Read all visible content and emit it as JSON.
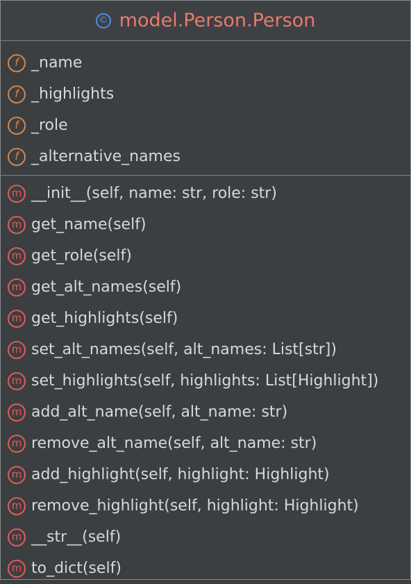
{
  "class": {
    "icon": "class-icon",
    "icon_glyph": "©",
    "name": "model.Person.Person"
  },
  "fields": [
    {
      "icon": "field-icon",
      "glyph": "f",
      "label": "_name"
    },
    {
      "icon": "field-icon",
      "glyph": "f",
      "label": "_highlights"
    },
    {
      "icon": "field-icon",
      "glyph": "f",
      "label": "_role"
    },
    {
      "icon": "field-icon",
      "glyph": "f",
      "label": "_alternative_names"
    }
  ],
  "methods": [
    {
      "icon": "method-icon",
      "glyph": "m",
      "label": "__init__(self, name: str, role: str)"
    },
    {
      "icon": "method-icon",
      "glyph": "m",
      "label": "get_name(self)"
    },
    {
      "icon": "method-icon",
      "glyph": "m",
      "label": "get_role(self)"
    },
    {
      "icon": "method-icon",
      "glyph": "m",
      "label": "get_alt_names(self)"
    },
    {
      "icon": "method-icon",
      "glyph": "m",
      "label": "get_highlights(self)"
    },
    {
      "icon": "method-icon",
      "glyph": "m",
      "label": "set_alt_names(self, alt_names: List[str])"
    },
    {
      "icon": "method-icon",
      "glyph": "m",
      "label": "set_highlights(self, highlights: List[Highlight])"
    },
    {
      "icon": "method-icon",
      "glyph": "m",
      "label": "add_alt_name(self, alt_name: str)"
    },
    {
      "icon": "method-icon",
      "glyph": "m",
      "label": "remove_alt_name(self, alt_name: str)"
    },
    {
      "icon": "method-icon",
      "glyph": "m",
      "label": "add_highlight(self, highlight: Highlight)"
    },
    {
      "icon": "method-icon",
      "glyph": "m",
      "label": "remove_highlight(self, highlight: Highlight)"
    },
    {
      "icon": "method-icon",
      "glyph": "m",
      "label": "__str__(self)"
    },
    {
      "icon": "method-icon",
      "glyph": "m",
      "label": "to_dict(self)"
    }
  ],
  "colors": {
    "background": "#3c3f41",
    "border": "#8a8d90",
    "class_icon": "#4b8fe6",
    "class_name": "#e97a6f",
    "field_icon": "#d4874a",
    "method_icon": "#e25a58",
    "text": "#d8d8d8"
  }
}
